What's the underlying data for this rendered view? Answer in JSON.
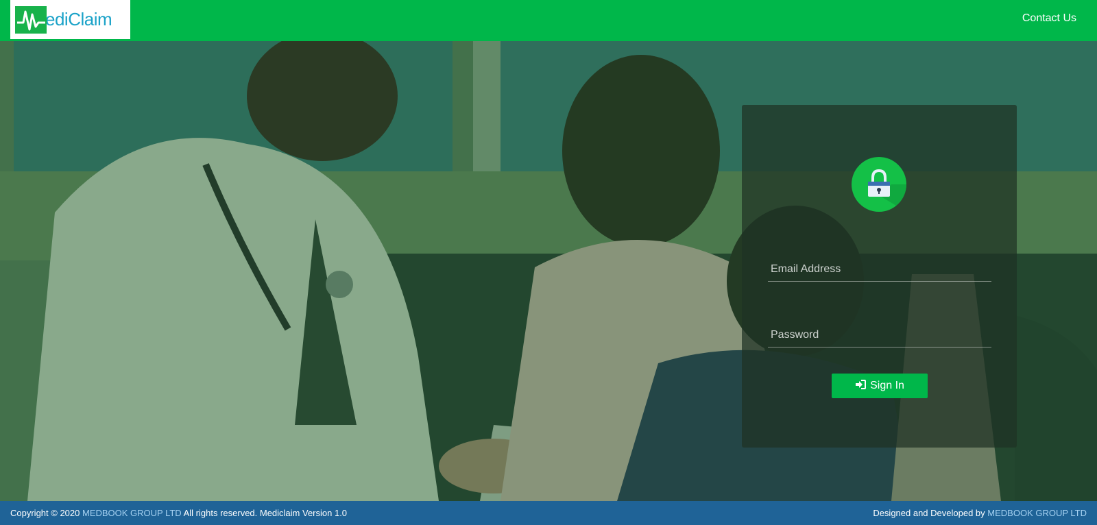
{
  "header": {
    "logo_text": "ediClaim",
    "contact_label": "Contact Us"
  },
  "login": {
    "email_placeholder": "Email Address",
    "password_placeholder": "Password",
    "signin_label": "Sign In",
    "signin_icon": "sign-in-icon",
    "lock_icon": "padlock-icon"
  },
  "footer": {
    "copyright_prefix": "Copyright © 2020",
    "company_link": "MEDBOOK GROUP LTD",
    "copyright_suffix": "All rights reserved. Mediclaim Version 1.0",
    "designed_prefix": "Designed and Developed by",
    "designed_company_link": "MEDBOOK GROUP LTD"
  },
  "colors": {
    "brand_green": "#00b74a",
    "footer_blue": "#1f6397",
    "logo_text": "#1aa2c8",
    "footer_link": "#a6d2f2"
  }
}
